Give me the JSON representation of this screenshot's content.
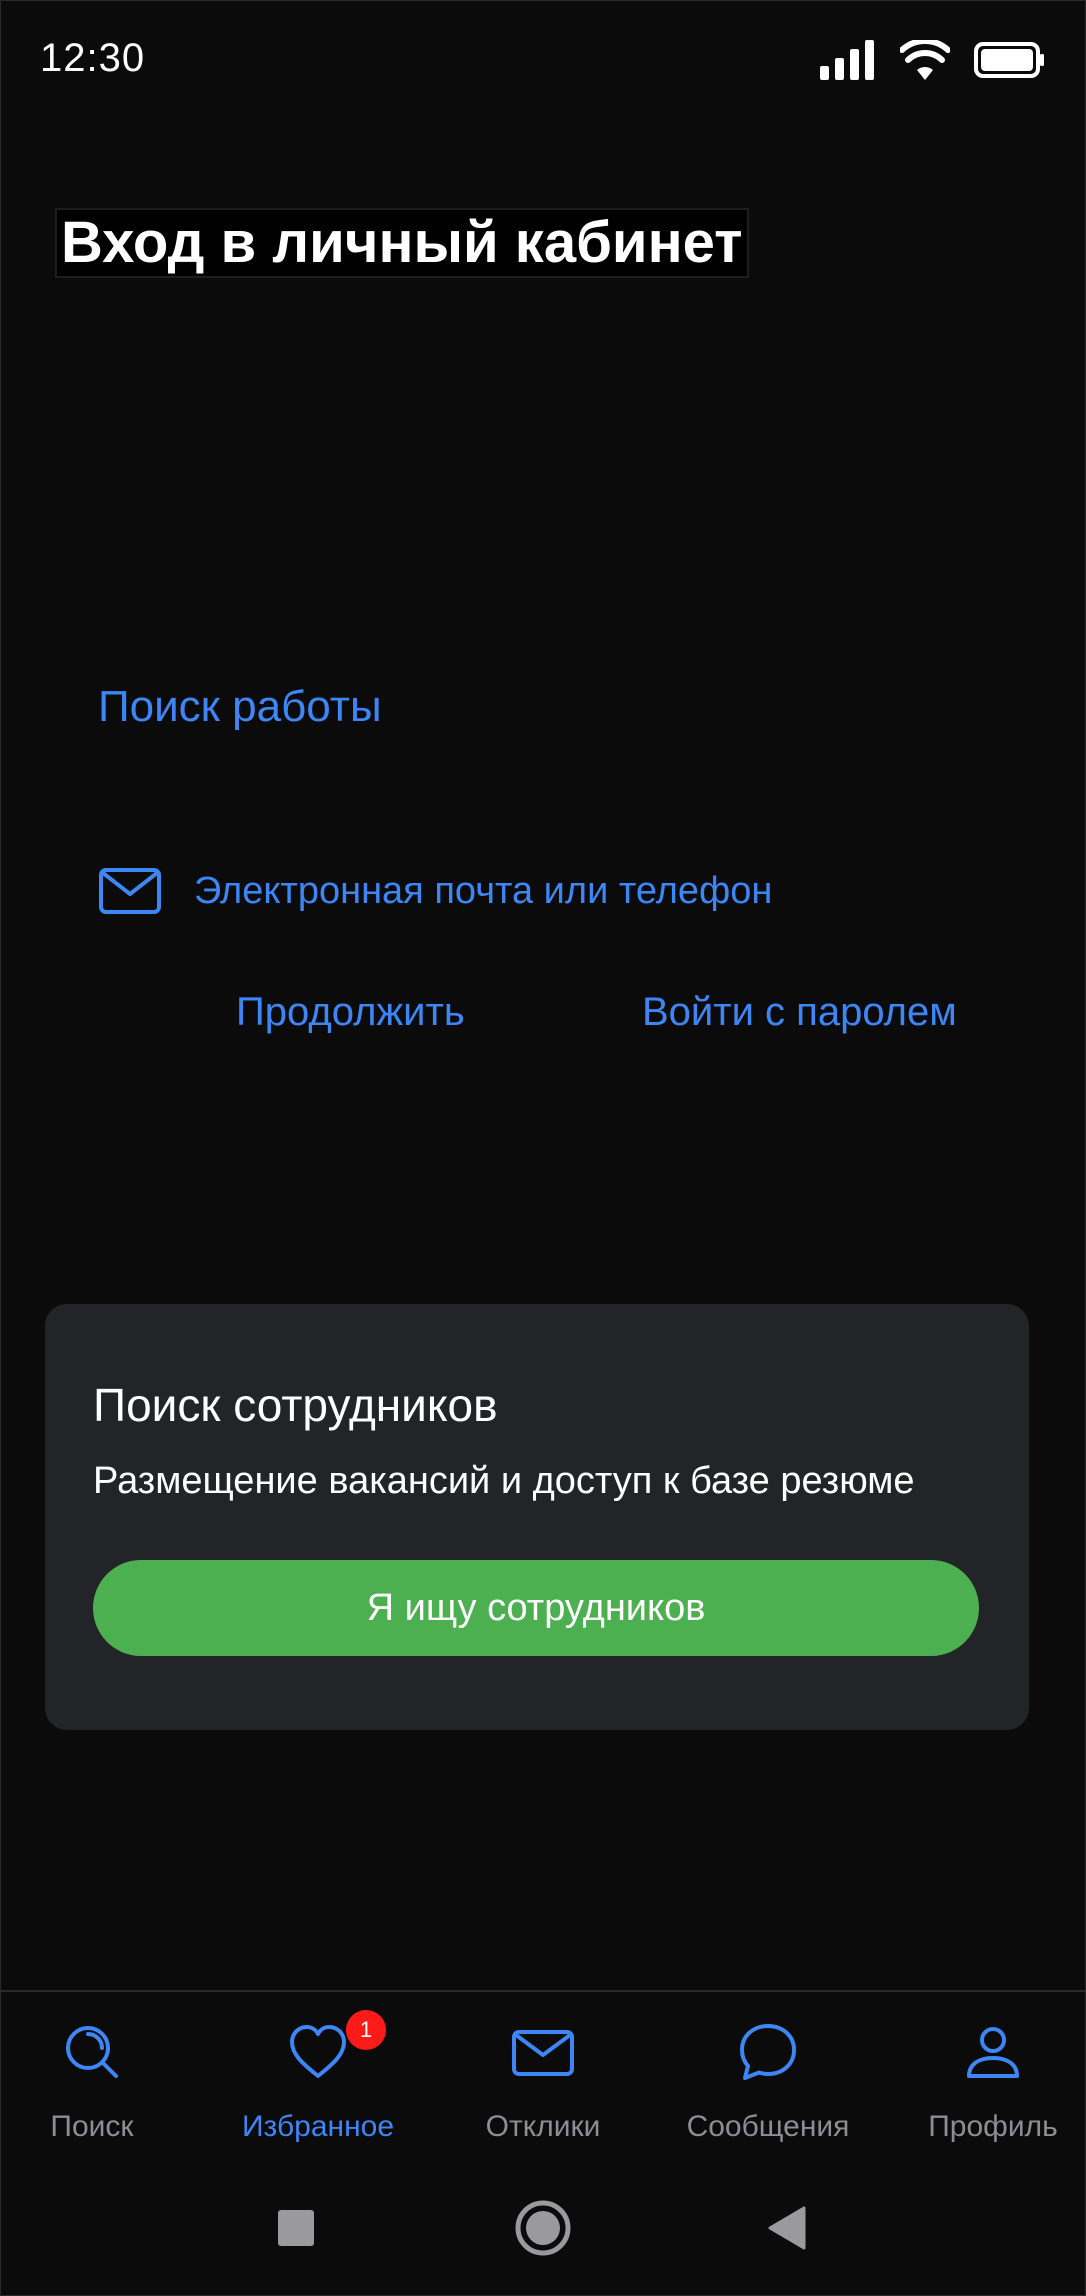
{
  "status_bar": {
    "time": "12:30",
    "icons": [
      "signal-icon",
      "wifi-icon",
      "battery-icon"
    ]
  },
  "page_title": "Вход в личный кабинет",
  "job_search": {
    "title": "Поиск работы",
    "field_label": "Электронная почта или телефон",
    "field_icon": "mail-icon",
    "continue_label": "Продолжить",
    "password_login_label": "Войти с паролем"
  },
  "employer_card": {
    "title": "Поиск сотрудников",
    "subtitle": "Размещение вакансий и доступ к базе резюме",
    "button_label": "Я ищу сотрудников"
  },
  "tabs": [
    {
      "label": "Поиск",
      "icon": "search-icon",
      "active": false
    },
    {
      "label": "Избранное",
      "icon": "heart-icon",
      "active": true,
      "badge": "1"
    },
    {
      "label": "Отклики",
      "icon": "envelope-icon",
      "active": false
    },
    {
      "label": "Сообщения",
      "icon": "chat-bubble-icon",
      "active": false
    },
    {
      "label": "Профиль",
      "icon": "profile-icon",
      "active": false
    }
  ],
  "colors": {
    "background": "#0b0b0c",
    "accent": "#3d86f6",
    "card": "#232427",
    "primary_button": "#4caf50",
    "badge": "#ff1a1a",
    "inactive_tab": "#8d8e93"
  }
}
